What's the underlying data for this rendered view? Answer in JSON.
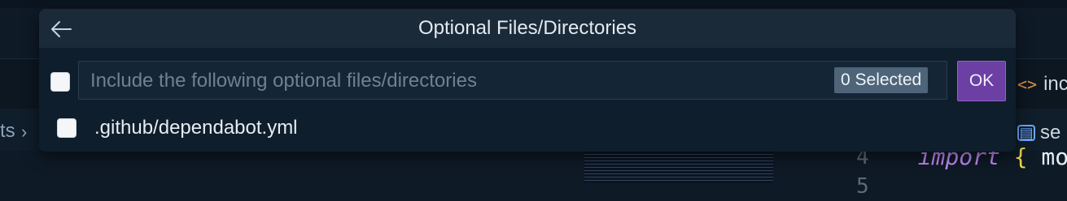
{
  "dialog": {
    "title": "Optional Files/Directories",
    "back_icon": "arrow-left-icon",
    "input": {
      "placeholder": "Include the following optional files/directories",
      "value": ""
    },
    "selected_count_label": "0 Selected",
    "ok_label": "OK",
    "items": [
      {
        "label": ".github/dependabot.yml",
        "checked": false
      }
    ]
  },
  "background": {
    "breadcrumb_left": "ts",
    "tab_right": "inc",
    "breadcrumb_right": "se",
    "line_numbers": [
      "4",
      "5"
    ],
    "code_keyword": "import",
    "code_brace": "{",
    "code_rest": "mod"
  },
  "colors": {
    "ok_button": "#6b3fa3",
    "badge": "#4e6479",
    "dialog_bg": "#0f1e2c",
    "header_bg": "#1a2a39"
  }
}
